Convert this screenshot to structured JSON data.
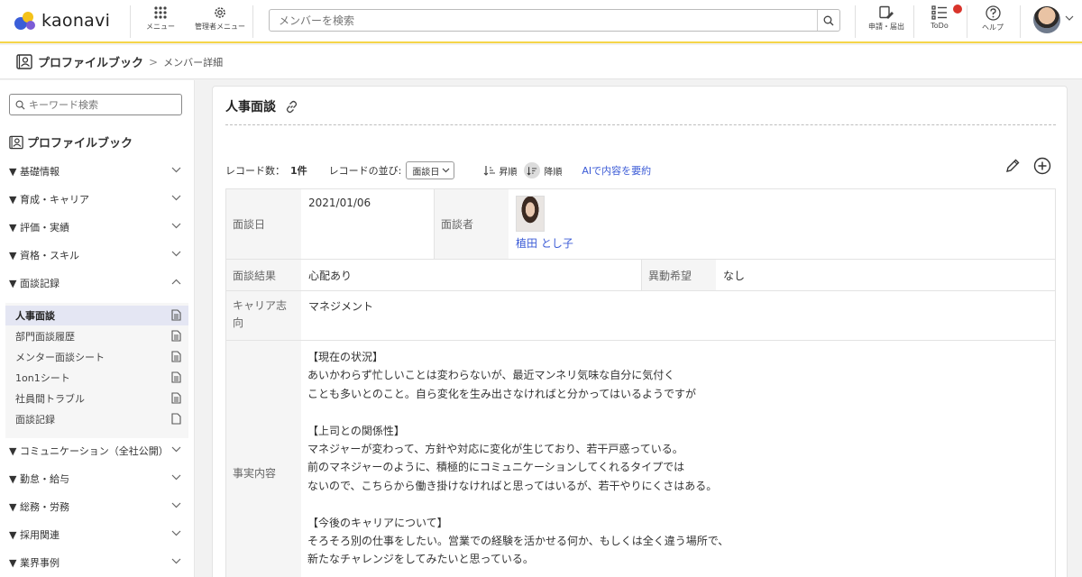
{
  "app": {
    "logo_text": "kaonavi"
  },
  "topnav": {
    "menu_label": "メニュー",
    "admin_menu_label": "管理者メニュー",
    "search_placeholder": "メンバーを検索",
    "requests_label": "申請・届出",
    "todo_label": "ToDo",
    "help_label": "ヘルプ",
    "todo_badge_color": "#d9342b",
    "accent_color": "#f5d54a"
  },
  "breadcrumb": {
    "title": "プロファイルブック",
    "separator": ">",
    "current": "メンバー詳細"
  },
  "sidebar": {
    "search_placeholder": "キーワード検索",
    "heading": "プロファイルブック",
    "categories": [
      {
        "label": "▼ 基礎情報",
        "expanded": false
      },
      {
        "label": "▼ 育成・キャリア",
        "expanded": false
      },
      {
        "label": "▼ 評価・実績",
        "expanded": false
      },
      {
        "label": "▼ 資格・スキル",
        "expanded": false
      },
      {
        "label": "▼ 面談記録",
        "expanded": true
      },
      {
        "label": "▼ コミュニケーション（全社公開）",
        "expanded": false
      },
      {
        "label": "▼ 勤怠・給与",
        "expanded": false
      },
      {
        "label": "▼ 総務・労務",
        "expanded": false
      },
      {
        "label": "▼ 採用関連",
        "expanded": false
      },
      {
        "label": "▼ 業界事例",
        "expanded": false
      }
    ],
    "subitems": [
      {
        "label": "人事面談",
        "active": true,
        "icon": "document-filled-icon"
      },
      {
        "label": "部門面談履歴",
        "active": false,
        "icon": "document-filled-icon"
      },
      {
        "label": "メンター面談シート",
        "active": false,
        "icon": "document-filled-icon"
      },
      {
        "label": "1on1シート",
        "active": false,
        "icon": "document-filled-icon"
      },
      {
        "label": "社員間トラブル",
        "active": false,
        "icon": "document-filled-icon"
      },
      {
        "label": "面談記録",
        "active": false,
        "icon": "document-empty-icon"
      }
    ]
  },
  "main": {
    "title": "人事面談",
    "toolbar": {
      "count_label": "レコード数：",
      "count_value": "1件",
      "sort_label": "レコードの並び:",
      "sort_selected": "面談日",
      "asc_label": "昇順",
      "desc_label": "降順",
      "ai_summary_label": "AIで内容を要約"
    },
    "record": {
      "date_label": "面談日",
      "date_value": "2021/01/06",
      "interviewer_label": "面談者",
      "interviewer_name": "植田 とし子",
      "result_label": "面談結果",
      "result_value": "心配あり",
      "transfer_label": "異動希望",
      "transfer_value": "なし",
      "career_label": "キャリア志向",
      "career_value": "マネジメント",
      "content_label": "事実内容",
      "content_lines": [
        "【現在の状況】",
        "あいかわらず忙しいことは変わらないが、最近マンネリ気味な自分に気付く",
        "ことも多いとのこと。自ら変化を生み出さなければと分かってはいるようですが",
        "",
        "【上司との関係性】",
        "マネジャーが変わって、方針や対応に変化が生じており、若干戸惑っている。",
        "前のマネジャーのように、積極的にコミュニケーションしてくれるタイプでは",
        "ないので、こちらから働き掛けなければと思ってはいるが、若干やりにくさはある。",
        "",
        "【今後のキャリアについて】",
        "そろそろ別の仕事をしたい。営業での経験を活かせる何か、もしくは全く違う場所で、",
        "新たなチャレンジをしてみたいと思っている。"
      ]
    }
  }
}
